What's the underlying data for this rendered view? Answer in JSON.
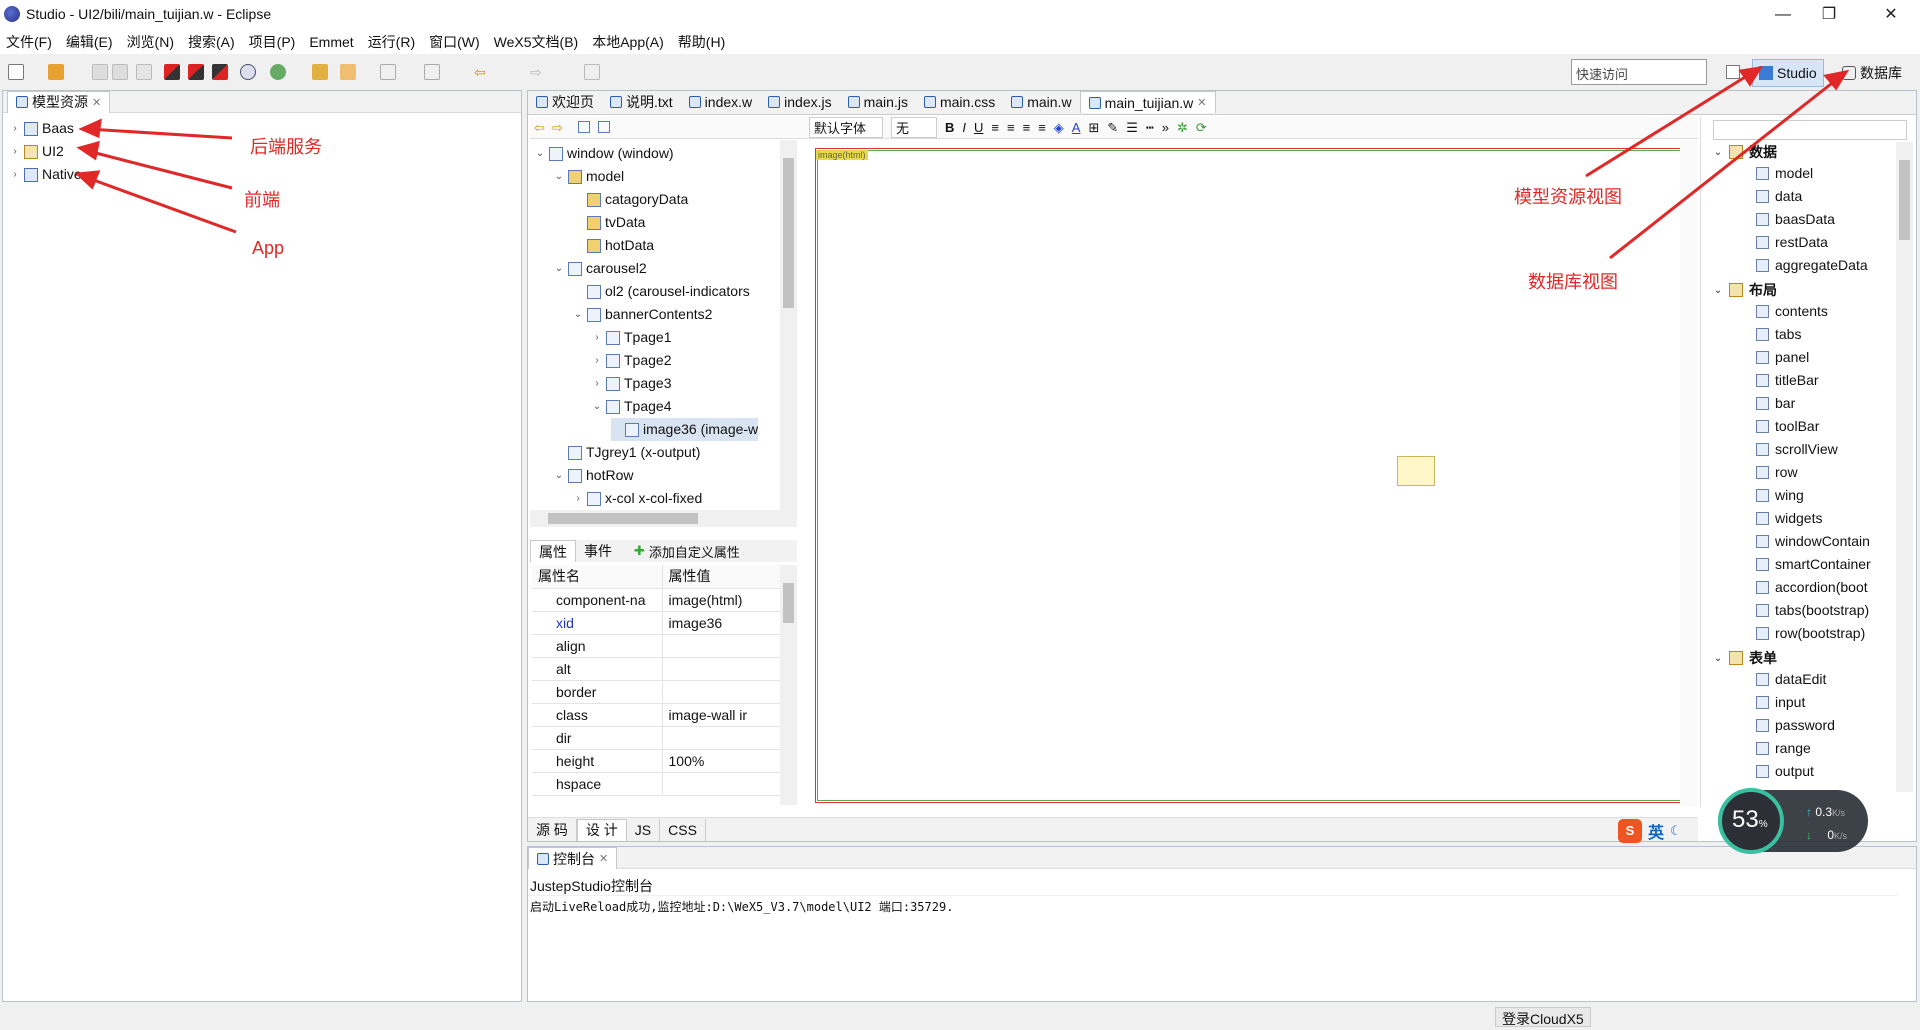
{
  "window": {
    "title": "Studio - UI2/bili/main_tuijian.w - Eclipse",
    "min": "—",
    "restore": "❐",
    "close": "✕"
  },
  "menu": [
    "文件(F)",
    "编辑(E)",
    "浏览(N)",
    "搜索(A)",
    "项目(P)",
    "Emmet",
    "运行(R)",
    "窗口(W)",
    "WeX5文档(B)",
    "本地App(A)",
    "帮助(H)"
  ],
  "quick_access": "快速访问",
  "perspectives": {
    "studio": "Studio",
    "db": "数据库"
  },
  "left": {
    "title": "模型资源",
    "items": [
      "Baas",
      "UI2",
      "Native"
    ]
  },
  "annotations": {
    "baas": "后端服务",
    "ui2": "前端",
    "native": "App",
    "model_view": "模型资源视图",
    "db_view": "数据库视图"
  },
  "editor_tabs": [
    "欢迎页",
    "说明.txt",
    "index.w",
    "index.js",
    "main.js",
    "main.css",
    "main.w",
    "main_tuijian.w"
  ],
  "outline": [
    {
      "label": "window (window)",
      "arrow": "v"
    },
    {
      "label": "model",
      "arrow": "v"
    },
    {
      "label": "catagoryData",
      "arrow": ""
    },
    {
      "label": "tvData",
      "arrow": ""
    },
    {
      "label": "hotData",
      "arrow": ""
    },
    {
      "label": "carousel2",
      "arrow": "v"
    },
    {
      "label": "ol2 (carousel-indicators",
      "arrow": ""
    },
    {
      "label": "bannerContents2",
      "arrow": "v"
    },
    {
      "label": "Tpage1",
      "arrow": ">"
    },
    {
      "label": "Tpage2",
      "arrow": ">"
    },
    {
      "label": "Tpage3",
      "arrow": ">"
    },
    {
      "label": "Tpage4",
      "arrow": "v"
    },
    {
      "label": "image36 (image-w",
      "arrow": ""
    },
    {
      "label": "TJgrey1 (x-output)",
      "arrow": ""
    },
    {
      "label": "hotRow",
      "arrow": "v"
    },
    {
      "label": "x-col x-col-fixed",
      "arrow": ">"
    }
  ],
  "editor_toolbar": {
    "font": "默认字体",
    "size": "无"
  },
  "canvas": {
    "label": "image(html)"
  },
  "props": {
    "tabs": [
      "属性",
      "事件"
    ],
    "add": "添加自定义属性",
    "head": [
      "属性名",
      "属性值"
    ],
    "rows": [
      [
        "component-na",
        "image(html)"
      ],
      [
        "xid",
        "image36"
      ],
      [
        "align",
        ""
      ],
      [
        "alt",
        ""
      ],
      [
        "border",
        ""
      ],
      [
        "class",
        "image-wall ir"
      ],
      [
        "dir",
        ""
      ],
      [
        "height",
        "100%"
      ],
      [
        "hspace",
        ""
      ]
    ]
  },
  "bottom_tabs": [
    "源 码",
    "设 计",
    "JS",
    "CSS"
  ],
  "console": {
    "title": "控制台",
    "name": "JustepStudio控制台",
    "line": "启动LiveReload成功,监控地址:D:\\WeX5_V3.7\\model\\UI2 端口:35729."
  },
  "palette": {
    "groups": [
      {
        "name": "数据",
        "items": [
          "model",
          "data",
          "baasData",
          "restData",
          "aggregateData"
        ]
      },
      {
        "name": "布局",
        "items": [
          "contents",
          "tabs",
          "panel",
          "titleBar",
          "bar",
          "toolBar",
          "scrollView",
          "row",
          "wing",
          "widgets",
          "windowContain",
          "smartContainer",
          "accordion(boot",
          "tabs(bootstrap)",
          "row(bootstrap)"
        ]
      },
      {
        "name": "表单",
        "items": [
          "dataEdit",
          "input",
          "password",
          "range",
          "output"
        ]
      }
    ]
  },
  "widget": {
    "pct": "53",
    "unit": "%",
    "up": "0.3",
    "down": "0",
    "rate": "K/s"
  },
  "ime": {
    "s": "S",
    "en": "英"
  },
  "status": "登录CloudX5"
}
